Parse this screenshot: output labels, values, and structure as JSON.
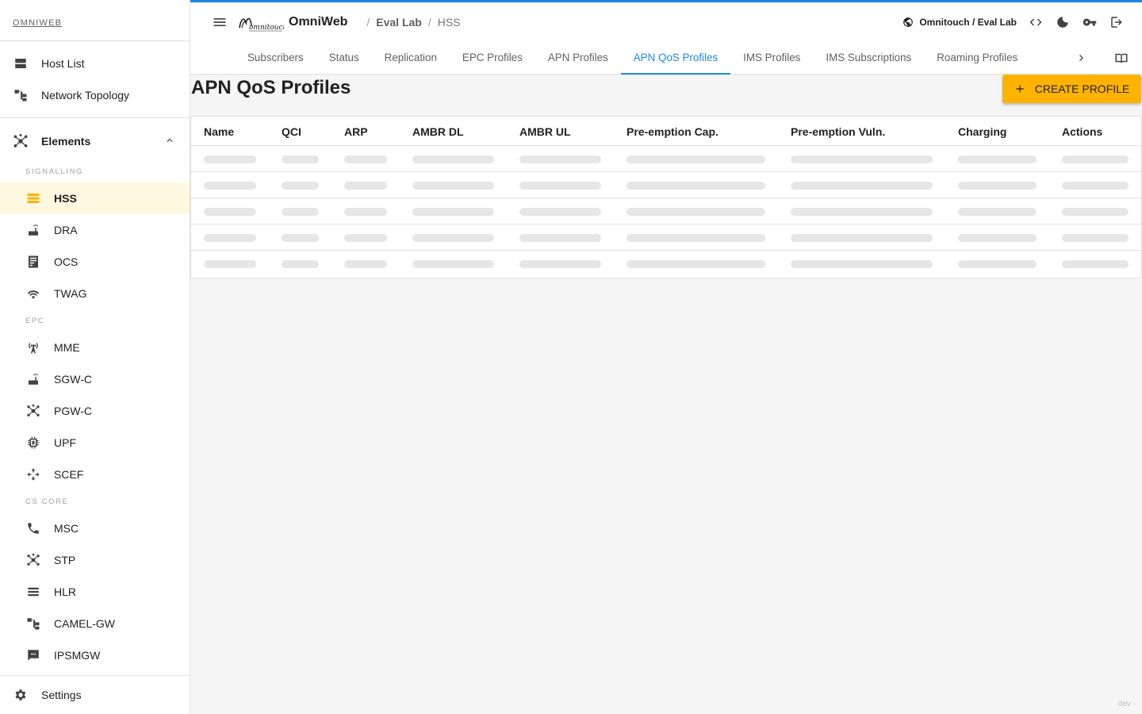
{
  "sidebar": {
    "brand": "OMNIWEB",
    "top_items": [
      {
        "label": "Host List",
        "icon": "dns-icon"
      },
      {
        "label": "Network Topology",
        "icon": "account-tree-icon"
      }
    ],
    "group": {
      "label": "Elements",
      "icon": "hub-icon",
      "expanded": true
    },
    "sections": [
      {
        "label": "SIGNALLING",
        "items": [
          {
            "label": "HSS",
            "icon": "storage-icon",
            "active": true
          },
          {
            "label": "DRA",
            "icon": "router-icon"
          },
          {
            "label": "OCS",
            "icon": "receipt-icon"
          },
          {
            "label": "TWAG",
            "icon": "wifi-icon"
          }
        ]
      },
      {
        "label": "EPC",
        "items": [
          {
            "label": "MME",
            "icon": "cell-tower-icon"
          },
          {
            "label": "SGW-C",
            "icon": "router-icon"
          },
          {
            "label": "PGW-C",
            "icon": "hub-icon"
          },
          {
            "label": "UPF",
            "icon": "memory-chip-icon"
          },
          {
            "label": "SCEF",
            "icon": "move-arrows-icon"
          }
        ]
      },
      {
        "label": "CS CORE",
        "items": [
          {
            "label": "MSC",
            "icon": "phone-icon"
          },
          {
            "label": "STP",
            "icon": "hub-icon"
          },
          {
            "label": "HLR",
            "icon": "list-icon"
          },
          {
            "label": "CAMEL-GW",
            "icon": "account-tree-icon"
          },
          {
            "label": "IPSMGW",
            "icon": "sms-icon"
          }
        ]
      }
    ],
    "settings": "Settings"
  },
  "header": {
    "app_title": "OmniWeb",
    "breadcrumbs": [
      "Eval Lab",
      "HSS"
    ],
    "tenant": "Omnitouch / Eval Lab"
  },
  "tabs": [
    {
      "label": "Subscribers"
    },
    {
      "label": "Status"
    },
    {
      "label": "Replication"
    },
    {
      "label": "EPC Profiles"
    },
    {
      "label": "APN Profiles"
    },
    {
      "label": "APN QoS Profiles",
      "active": true
    },
    {
      "label": "IMS Profiles"
    },
    {
      "label": "IMS Subscriptions"
    },
    {
      "label": "Roaming Profiles"
    }
  ],
  "page": {
    "title": "APN QoS Profiles",
    "create_label": "CREATE PROFILE"
  },
  "table": {
    "columns": [
      "Name",
      "QCI",
      "ARP",
      "AMBR DL",
      "AMBR UL",
      "Pre-emption Cap.",
      "Pre-emption Vuln.",
      "Charging",
      "Actions"
    ],
    "loading_rows": 5
  },
  "footer": {
    "env": "dev ·"
  },
  "colors": {
    "accent": "#1e88e5",
    "primary_button": "#ffb300",
    "active_bg": "#fff8e1"
  }
}
